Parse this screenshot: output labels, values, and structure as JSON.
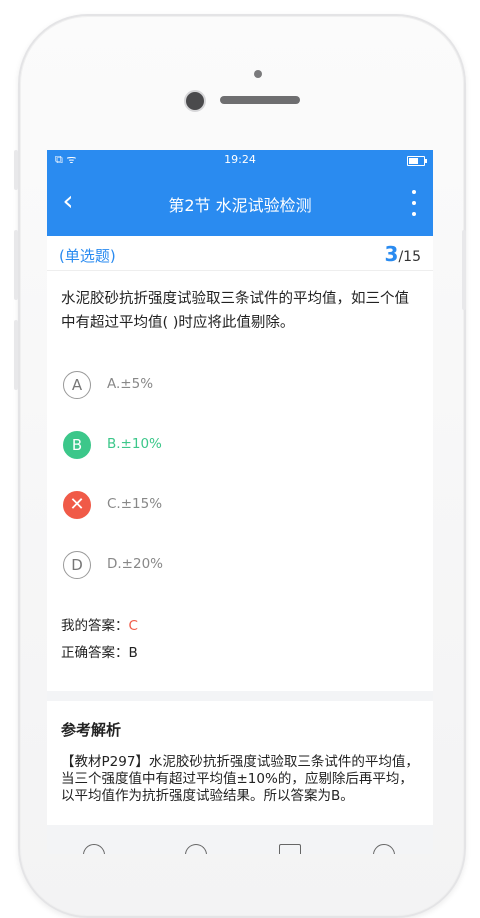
{
  "status_bar": {
    "time": "19:24",
    "left_icons": "⧉ ᯤ"
  },
  "navbar": {
    "back_icon": "‹",
    "title": "第2节 水泥试验检测"
  },
  "question": {
    "type": "(单选题)",
    "current": "3",
    "total": "/15",
    "text": "水泥胶砂抗折强度试验取三条试件的平均值，如三个值中有超过平均值( )时应将此值剔除。"
  },
  "options": [
    {
      "letter": "A",
      "text": "A.±5%",
      "state": "normal"
    },
    {
      "letter": "B",
      "text": "B.±10%",
      "state": "correct"
    },
    {
      "letter": "✕",
      "text": "C.±15%",
      "state": "wrong"
    },
    {
      "letter": "D",
      "text": "D.±20%",
      "state": "normal"
    }
  ],
  "answers": {
    "mine_label": "我的答案：",
    "mine_value": "C",
    "correct_label": "正确答案：",
    "correct_value": "B"
  },
  "analysis": {
    "title": "参考解析",
    "text": "【教材P297】水泥胶砂抗折强度试验取三条试件的平均值，当三个强度值中有超过平均值±10%的，应剔除后再平均，以平均值作为抗折强度试验结果。所以答案为B。"
  },
  "colors": {
    "primary": "#2a8bf0",
    "correct": "#3cc78a",
    "wrong": "#f05a48"
  }
}
